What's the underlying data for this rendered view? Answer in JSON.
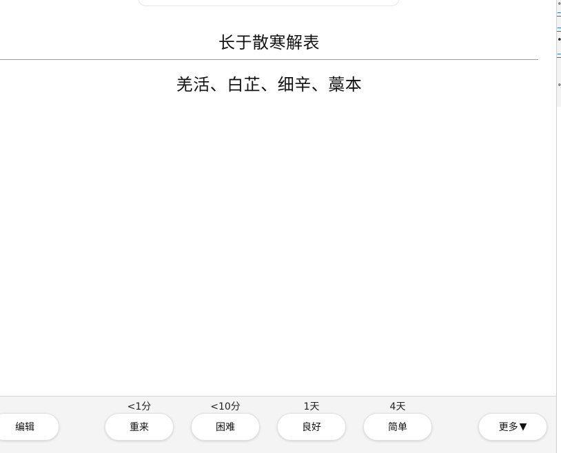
{
  "card": {
    "front": "长于散寒解表",
    "back": "羌活、白芷、细辛、藁本"
  },
  "side_panel": {
    "glyphs": [
      "•",
      "–",
      "—",
      "•",
      "–",
      "•"
    ]
  },
  "bottom_bar": {
    "edit_label": "编辑",
    "answers": [
      {
        "label": "重来",
        "interval": "<1分"
      },
      {
        "label": "困难",
        "interval": "<10分"
      },
      {
        "label": "良好",
        "interval": "1天"
      },
      {
        "label": "简单",
        "interval": "4天"
      }
    ],
    "more_label": "更多",
    "more_icon": "triangle-down-icon"
  }
}
